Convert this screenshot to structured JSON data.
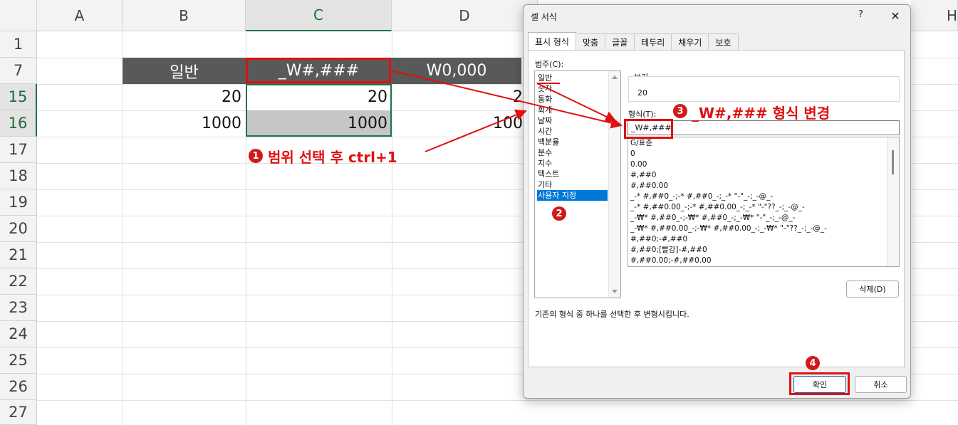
{
  "sheet": {
    "columns": [
      "A",
      "B",
      "C",
      "D",
      "H"
    ],
    "rows": [
      "1",
      "7",
      "15",
      "16",
      "17",
      "18",
      "19",
      "20",
      "21",
      "22",
      "23",
      "24",
      "25",
      "26",
      "27"
    ],
    "header_row": {
      "b": "일반",
      "c": "_W#,###",
      "d": "W0,000"
    },
    "row15": {
      "b": "20",
      "c": "20",
      "d": "2"
    },
    "row16": {
      "b": "1000",
      "c": "1000",
      "d": "100"
    }
  },
  "dialog": {
    "title": "셀 서식",
    "help": "?",
    "close": "✕",
    "tabs": [
      "표시 형식",
      "맞춤",
      "글꼴",
      "테두리",
      "채우기",
      "보호"
    ],
    "category_label": "범주(C):",
    "categories": [
      "일반",
      "숫자",
      "통화",
      "회계",
      "날짜",
      "시간",
      "백분율",
      "분수",
      "지수",
      "텍스트",
      "기타",
      "사용자 지정"
    ],
    "selected_category": "사용자 지정",
    "preview_label": "보기",
    "preview_value": "20",
    "format_label": "형식(T):",
    "format_value": "_W#,###",
    "formats": [
      "G/표준",
      "0",
      "0.00",
      "#,##0",
      "#,##0.00",
      "_-* #,##0_-;-* #,##0_-;_-* \"-\"_-;_-@_-",
      "_-* #,##0.00_-;-* #,##0.00_-;_-* \"-\"??_-;_-@_-",
      "_-₩* #,##0_-;-₩* #,##0_-;_-₩* \"-\"_-;_-@_-",
      "_-₩* #,##0.00_-;-₩* #,##0.00_-;_-₩* \"-\"??_-;_-@_-",
      "#,##0;-#,##0",
      "#,##0;[빨강]-#,##0",
      "#,##0.00;-#,##0.00"
    ],
    "delete_button": "삭제(D)",
    "description": "기존의 형식 중 하나를 선택한 후 변형시킵니다.",
    "ok_button": "확인",
    "cancel_button": "취소"
  },
  "annotations": {
    "step1_num": "1",
    "step1_text": "범위 선택 후 ctrl+1",
    "step2_num": "2",
    "step3_num": "3",
    "step3_text": "_W#,### 형식 변경",
    "step4_num": "4"
  },
  "colors": {
    "annotation_red": "#e01010",
    "header_band": "#595959",
    "selection_green": "#217346",
    "list_selection": "#0078d7"
  }
}
